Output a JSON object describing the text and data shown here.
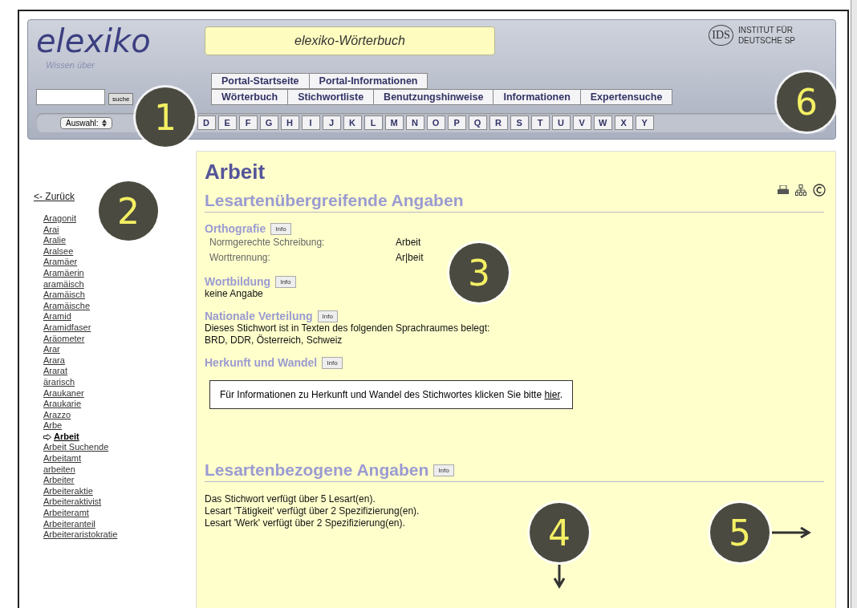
{
  "header": {
    "logo": "elexiko",
    "logo_tagline": "Wissen über",
    "title": "elexiko-Wörterbuch",
    "institute_logo": "IDS",
    "institute_lines": [
      "INSTITUT FÜR",
      "DEUTSCHE SP"
    ]
  },
  "search": {
    "button": "suche"
  },
  "portal_nav": [
    "Portal-Startseite",
    "Portal-Informationen"
  ],
  "main_nav": [
    "Wörterbuch",
    "Stichwortliste",
    "Benutzungshinweise",
    "Informationen",
    "Expertensuche"
  ],
  "alphabet": {
    "select": "Auswahl:",
    "letters": [
      "D",
      "E",
      "F",
      "G",
      "H",
      "I",
      "J",
      "K",
      "L",
      "M",
      "N",
      "O",
      "P",
      "Q",
      "R",
      "S",
      "T",
      "U",
      "V",
      "W",
      "X",
      "Y"
    ]
  },
  "sidebar": {
    "back": "<- Zurück",
    "items": [
      {
        "label": "Aragonit",
        "selected": false
      },
      {
        "label": "Arai",
        "selected": false
      },
      {
        "label": "Aralie",
        "selected": false
      },
      {
        "label": "Aralsee",
        "selected": false
      },
      {
        "label": "Aramäer",
        "selected": false
      },
      {
        "label": "Aramäerin",
        "selected": false
      },
      {
        "label": "aramäisch",
        "selected": false
      },
      {
        "label": "Aramäisch",
        "selected": false
      },
      {
        "label": "Aramäische",
        "selected": false
      },
      {
        "label": "Aramid",
        "selected": false
      },
      {
        "label": "Aramidfaser",
        "selected": false
      },
      {
        "label": "Aräometer",
        "selected": false
      },
      {
        "label": "Arar",
        "selected": false
      },
      {
        "label": "Arara",
        "selected": false
      },
      {
        "label": "Ararat",
        "selected": false
      },
      {
        "label": "ärarisch",
        "selected": false
      },
      {
        "label": "Araukaner",
        "selected": false
      },
      {
        "label": "Araukarie",
        "selected": false
      },
      {
        "label": "Arazzo",
        "selected": false
      },
      {
        "label": "Arbe",
        "selected": false
      },
      {
        "label": "Arbeit",
        "selected": true
      },
      {
        "label": "Arbeit Suchende",
        "selected": false
      },
      {
        "label": "Arbeitamt",
        "selected": false
      },
      {
        "label": "arbeiten",
        "selected": false
      },
      {
        "label": "Arbeiter",
        "selected": false
      },
      {
        "label": "Arbeiteraktie",
        "selected": false
      },
      {
        "label": "Arbeiteraktivist",
        "selected": false
      },
      {
        "label": "Arbeiteramt",
        "selected": false
      },
      {
        "label": "Arbeiteranteil",
        "selected": false
      },
      {
        "label": "Arbeiteraristokratie",
        "selected": false
      }
    ]
  },
  "entry": {
    "headword": "Arbeit",
    "section_1": "Lesartenübergreifende Angaben",
    "orthography": {
      "title": "Orthografie",
      "info": "Info",
      "rows": [
        {
          "label": "Normgerechte Schreibung:",
          "value": "Arbeit"
        },
        {
          "label": "Worttrennung:",
          "value": "Ar|beit"
        }
      ]
    },
    "word_formation": {
      "title": "Wortbildung",
      "info": "Info",
      "text": "keine Angabe"
    },
    "distribution": {
      "title": "Nationale Verteilung",
      "info": "Info",
      "lines": [
        "Dieses Stichwort ist in Texten des folgenden Sprachraumes belegt:",
        "BRD, DDR, Österreich, Schweiz"
      ]
    },
    "origin": {
      "title": "Herkunft und Wandel",
      "info": "Info",
      "notice": "Für Informationen zu Herkunft und Wandel des Stichwortes klicken Sie bitte",
      "link": "hier",
      "after": "."
    },
    "section_2": "Lesartenbezogene Angaben",
    "section_2_info": "Info",
    "summary": [
      "Das Stichwort verfügt über 5 Lesart(en).",
      "Lesart 'Tätigkeit' verfügt über 2 Spezifizierung(en).",
      "Lesart 'Werk' verfügt über 2 Spezifizierung(en)."
    ]
  },
  "annotations": [
    {
      "label": "1",
      "kind": "plain"
    },
    {
      "label": "2",
      "kind": "plain"
    },
    {
      "label": "3",
      "kind": "plain"
    },
    {
      "label": "4",
      "kind": "down"
    },
    {
      "label": "5",
      "kind": "right"
    },
    {
      "label": "6",
      "kind": "plain"
    }
  ]
}
